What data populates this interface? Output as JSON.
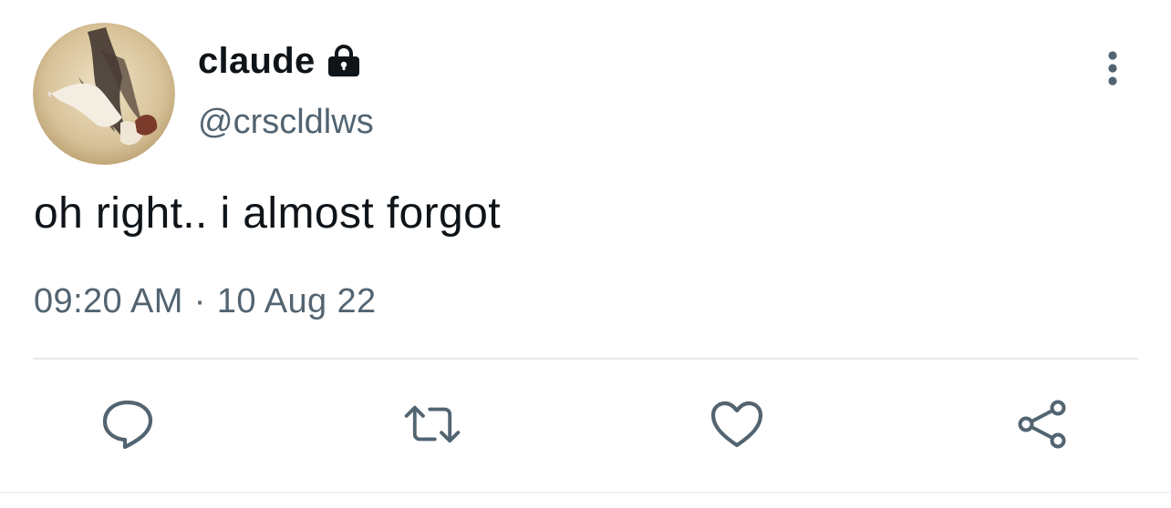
{
  "tweet": {
    "author": {
      "display_name": "claude",
      "handle": "@crscldlws",
      "protected": true,
      "lock_icon": "lock-icon",
      "avatar_description": "avatar"
    },
    "text": "oh right.. i almost forgot",
    "time": "09:20 AM",
    "separator": "·",
    "date": "10 Aug 22"
  },
  "actions": {
    "reply_icon": "speech-bubble-icon",
    "retweet_icon": "retweet-arrows-icon",
    "like_icon": "heart-icon",
    "share_icon": "share-nodes-icon",
    "more_icon": "vertical-ellipsis-icon"
  },
  "colors": {
    "text_primary": "#0f1419",
    "text_secondary": "#536471",
    "divider": "#e6e9eb",
    "background": "#ffffff"
  }
}
